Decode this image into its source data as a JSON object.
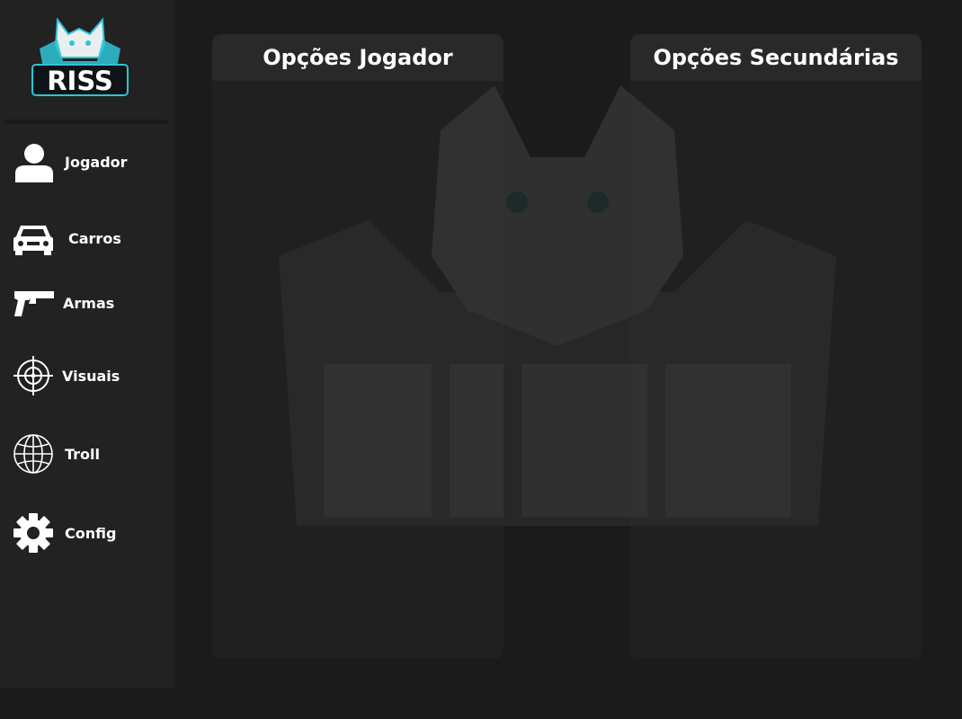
{
  "brand": {
    "logo_text": "RISS",
    "accent": "#2ec4d6"
  },
  "sidebar": {
    "items": [
      {
        "label": "Jogador",
        "icon": "user-icon"
      },
      {
        "label": "Carros",
        "icon": "car-icon"
      },
      {
        "label": "Armas",
        "icon": "pistol-icon"
      },
      {
        "label": "Visuais",
        "icon": "crosshair-icon"
      },
      {
        "label": "Troll",
        "icon": "globe-icon"
      },
      {
        "label": "Config",
        "icon": "gear-icon"
      }
    ]
  },
  "panels": {
    "primary": {
      "title": "Opções Jogador"
    },
    "secondary": {
      "title": "Opções Secundárias"
    }
  },
  "colors": {
    "background": "#1b1b1b",
    "sidebar": "#222222",
    "text": "#ffffff"
  }
}
